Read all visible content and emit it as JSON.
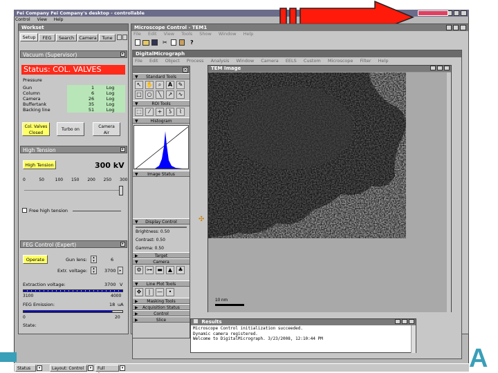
{
  "desktop": {
    "title": "Fei Company Fei Company's desktop - controllable",
    "menu": [
      "Control",
      "View",
      "Help"
    ]
  },
  "workset": {
    "title": "Workset",
    "tabs": [
      "Setup",
      "FEG",
      "Search",
      "Camera",
      "Tune"
    ]
  },
  "vacuum": {
    "title": "Vacuum (Supervisor)",
    "status": "Status:  COL. VALVES",
    "pressure_label": "Pressure",
    "rows": [
      {
        "name": "Gun",
        "value": "1",
        "unit": "Log"
      },
      {
        "name": "Column",
        "value": "6",
        "unit": "Log"
      },
      {
        "name": "Camera",
        "value": "26",
        "unit": "Log"
      },
      {
        "name": "Buffertank",
        "value": "35",
        "unit": "Log"
      },
      {
        "name": "Backing line",
        "value": "51",
        "unit": "Log"
      }
    ],
    "buttons": {
      "col_valves_line1": "Col. Valves",
      "col_valves_line2": "Closed",
      "turbo": "Turbo on",
      "camera_air_line1": "Camera",
      "camera_air_line2": "Air"
    }
  },
  "high_tension": {
    "title": "High Tension",
    "button": "High Tension",
    "value": "300 kV",
    "ticks": [
      "0",
      "50",
      "100",
      "150",
      "200",
      "250",
      "300"
    ],
    "free_ht": "Free high tension"
  },
  "feg": {
    "title": "FEG Control (Expert)",
    "operate": "Operate",
    "gun_lens_label": "Gun lens:",
    "gun_lens_value": "6",
    "extr_label": "Extr. voltage:",
    "extr_value": "3700",
    "extraction_label": "Extraction voltage:",
    "extraction_value": "3700",
    "extraction_unit": "V",
    "scale1_min": "3100",
    "scale1_max": "4000",
    "emission_label": "FEG Emission:",
    "emission_value": "18",
    "emission_unit": "uA",
    "scale2_min": "0",
    "scale2_max": "20",
    "state_label": "State:"
  },
  "microscope_control": {
    "title": "Microscope Control - TEM1",
    "menu": [
      "File",
      "Edit",
      "View",
      "Tools",
      "Show",
      "Window",
      "Help"
    ]
  },
  "digital_micrograph": {
    "title": "DigitalMicrograph",
    "menu": [
      "File",
      "Edit",
      "Object",
      "Process",
      "Analysis",
      "Window",
      "Camera",
      "EELS",
      "Custom",
      "Microscope",
      "Filter",
      "Help"
    ]
  },
  "tools": {
    "standard_tools": "Standard Tools",
    "roi_tools": "ROI Tools",
    "histogram": "Histogram",
    "image_status": "Image Status",
    "display_control": "Display Control",
    "brightness": "Brightness: 0.50",
    "contrast": "Contrast: 0.50",
    "gamma": "Gamma: 0.50",
    "target": "Target",
    "camera": "Camera",
    "line_plot": "Line Plot Tools",
    "masking": "Masking Tools",
    "acquisition": "Acquisition Status",
    "control": "Control",
    "slice": "Slice"
  },
  "image_window": {
    "title": "TEM Image",
    "scale_bar": "10 nm"
  },
  "results": {
    "title": "Results",
    "lines": [
      "Microscope Control initialization succeeded.",
      "Dynamic camera registered.",
      "Welcome to DigitalMicrograph.  3/23/2008, 12:10:44 PM"
    ]
  },
  "taskbar": {
    "items": [
      "Status",
      "Layout: Control",
      "Full Screen"
    ]
  },
  "colors": {
    "status_red": "#ff2a1a",
    "annotation_arrow": "#ff1a0a",
    "yellow_button": "#ffff66",
    "green_cell": "#b8e6b8",
    "accent_blue": "#0000cc"
  }
}
